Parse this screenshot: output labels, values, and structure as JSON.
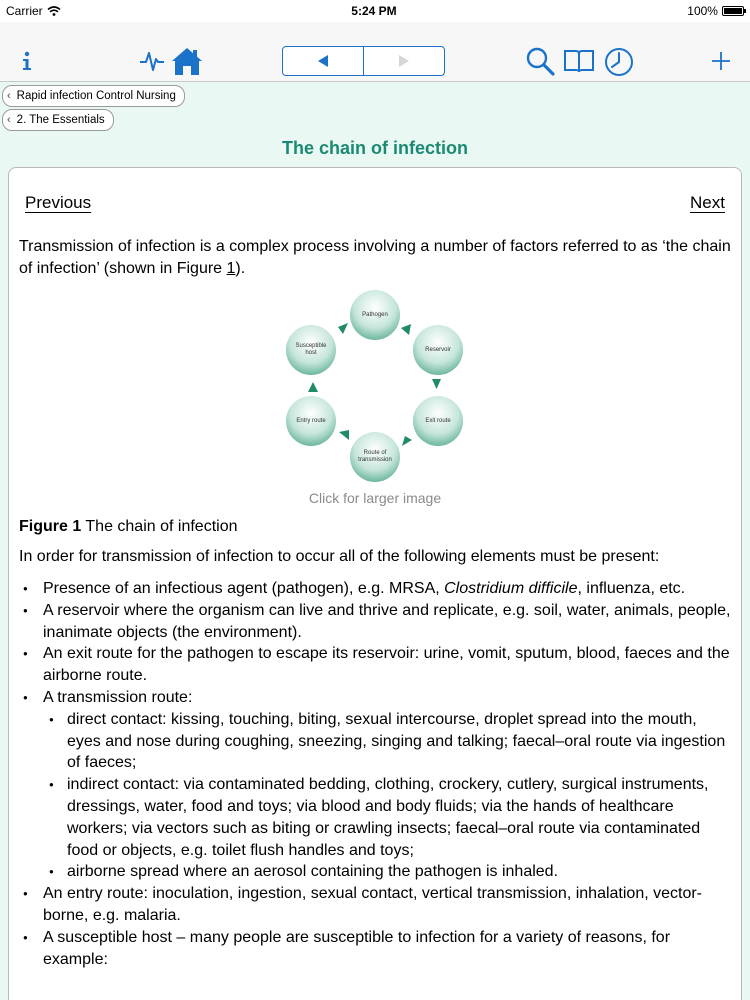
{
  "status": {
    "carrier": "Carrier",
    "time": "5:24 PM",
    "battery": "100%"
  },
  "breadcrumbs": [
    "Rapid infection Control Nursing",
    "2. The Essentials"
  ],
  "page_title": "The chain of infection",
  "nav": {
    "previous": "Previous",
    "next": "Next"
  },
  "intro": {
    "before": "Transmission of infection is a complex process involving a number of factors referred to as ‘the chain of infection’ (shown in Figure ",
    "link": "1",
    "after": ")."
  },
  "diagram": {
    "nodes": [
      "Pathogen",
      "Reservoir",
      "Exit route",
      "Route of transmission",
      "Entry route",
      "Susceptible host"
    ],
    "click_hint": "Click for larger image"
  },
  "figure_caption": {
    "label": "Figure 1",
    "text": " The chain of infection"
  },
  "lead": "In order for transmission of infection to occur all of the following elements must be present:",
  "items": {
    "i1a": "Presence of an infectious agent (pathogen), e.g. MRSA, ",
    "i1b": "Clostridium difficile",
    "i1c": ", influenza, etc.",
    "i2": "A reservoir where the organism can live and thrive and replicate, e.g. soil, water, animals, people, inanimate objects (the environment).",
    "i3": "An exit route for the pathogen to escape its reservoir: urine, vomit, sputum, blood, faeces and the airborne route.",
    "i4": "A transmission route:",
    "i4a": "direct contact: kissing, touching, biting, sexual intercourse, droplet spread into the mouth, eyes and nose during coughing, sneezing, singing and talking; faecal–oral route via ingestion of faeces;",
    "i4b": "indirect contact: via contaminated bedding, clothing, crockery, cutlery, surgical instruments, dressings, water, food and toys; via blood and body fluids; via the hands of healthcare workers; via vectors such as biting or crawling insects; faecal–oral route via contaminated food or objects, e.g. toilet flush handles and toys;",
    "i4c": "airborne spread where an aerosol containing the pathogen is inhaled.",
    "i5": "An entry route: inoculation, ingestion, sexual contact, vertical transmission, inhalation, vector-borne, e.g. malaria.",
    "i6": "A susceptible host – many people are susceptible to infection for a variety of reasons, for example:"
  }
}
